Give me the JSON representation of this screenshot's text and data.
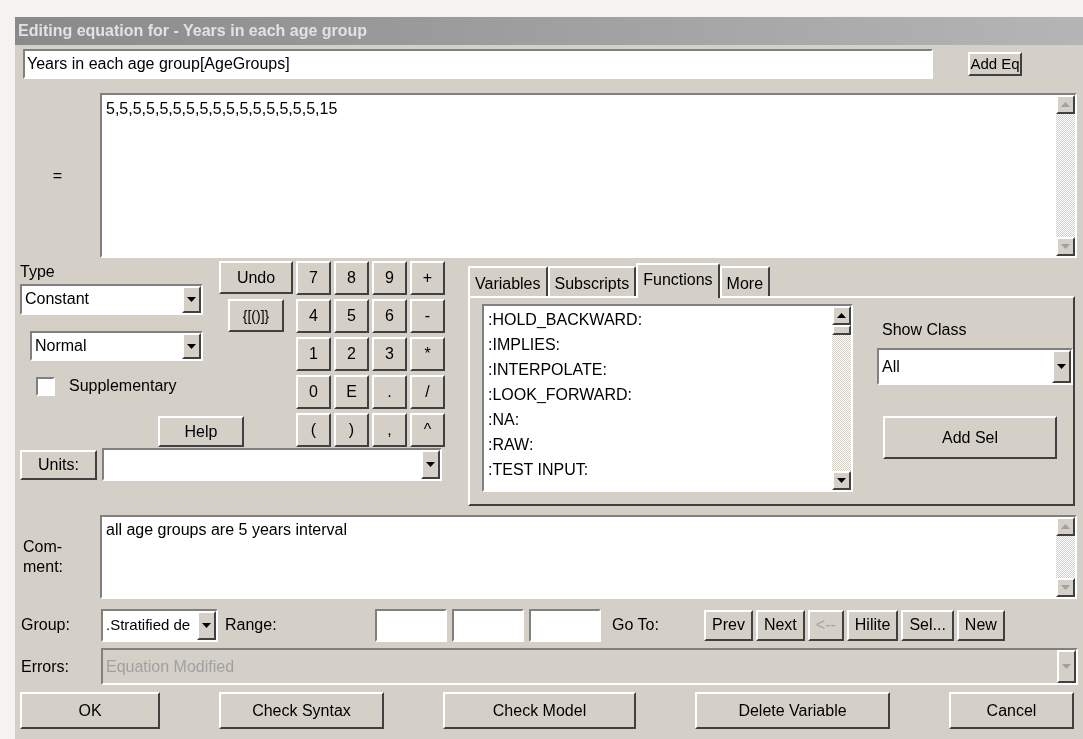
{
  "window": {
    "title": "Editing equation for - Years in each age group"
  },
  "name_field": {
    "value": "Years in each age group[AgeGroups]"
  },
  "add_eq_button": "Add Eq",
  "equals_label": "=",
  "equation": {
    "value": "5,5,5,5,5,5,5,5,5,5,5,5,5,5,5,5,15"
  },
  "type": {
    "label": "Type",
    "value": "Constant"
  },
  "subtype": {
    "value": "Normal"
  },
  "supplementary": {
    "label": "Supplementary",
    "checked": false
  },
  "help_button": "Help",
  "undo_button": "Undo",
  "brackets_button": "{[()]}",
  "keypad": [
    "7",
    "8",
    "9",
    "+",
    "4",
    "5",
    "6",
    "-",
    "1",
    "2",
    "3",
    "*",
    "0",
    "E",
    ".",
    "/",
    "(",
    ")",
    ",",
    "^"
  ],
  "tabs": [
    {
      "label": "Variables",
      "selected": false
    },
    {
      "label": "Subscripts",
      "selected": false
    },
    {
      "label": "Functions",
      "selected": true
    },
    {
      "label": "More",
      "selected": false
    }
  ],
  "function_list": [
    ":HOLD_BACKWARD:",
    ":IMPLIES:",
    ":INTERPOLATE:",
    ":LOOK_FORWARD:",
    ":NA:",
    ":RAW:",
    ":TEST INPUT:"
  ],
  "show_class": {
    "label": "Show Class",
    "value": "All"
  },
  "add_sel_button": "Add Sel",
  "units": {
    "button": "Units:"
  },
  "comment": {
    "label": "Com-ment:",
    "value": "all age groups are 5 years interval"
  },
  "group": {
    "label": "Group:",
    "value": ".Stratified de"
  },
  "range": {
    "label": "Range:"
  },
  "goto": {
    "label": "Go To:",
    "buttons": [
      {
        "label": "Prev",
        "disabled": false
      },
      {
        "label": "Next",
        "disabled": false
      },
      {
        "label": "<--",
        "disabled": true
      },
      {
        "label": "Hilite",
        "disabled": false
      },
      {
        "label": "Sel...",
        "disabled": false
      },
      {
        "label": "New",
        "disabled": false
      }
    ]
  },
  "errors": {
    "label": "Errors:",
    "value": "Equation Modified",
    "disabled": true
  },
  "buttons": [
    "OK",
    "Check Syntax",
    "Check Model",
    "Delete Variable",
    "Cancel"
  ]
}
